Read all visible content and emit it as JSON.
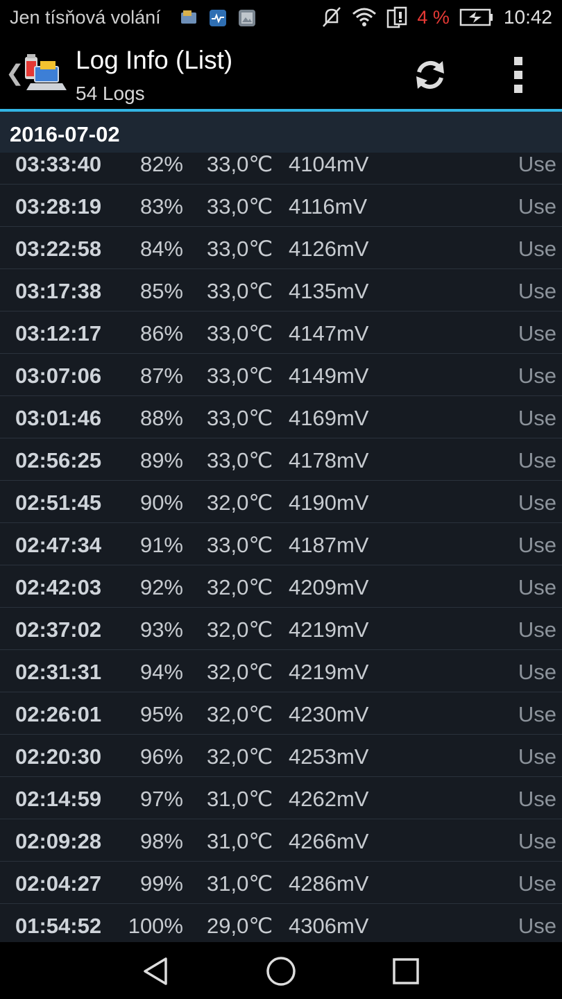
{
  "status_bar": {
    "carrier": "Jen tísňová volání",
    "battery_pct": "4 %",
    "time": "10:42",
    "notification_icons": [
      "sd-card-icon",
      "health-icon",
      "image-icon"
    ],
    "system_icons": [
      "mute-icon",
      "wifi-icon",
      "sim-icon",
      "battery-charging-icon"
    ]
  },
  "action_bar": {
    "title": "Log Info (List)",
    "subtitle": "54 Logs",
    "accent_color": "#33b5e5"
  },
  "section": {
    "date": "2016-07-02"
  },
  "rows": [
    {
      "time": "03:33:40",
      "pct": "82%",
      "temp": "33,0℃",
      "mv": "4104mV",
      "use": "Use"
    },
    {
      "time": "03:28:19",
      "pct": "83%",
      "temp": "33,0℃",
      "mv": "4116mV",
      "use": "Use"
    },
    {
      "time": "03:22:58",
      "pct": "84%",
      "temp": "33,0℃",
      "mv": "4126mV",
      "use": "Use"
    },
    {
      "time": "03:17:38",
      "pct": "85%",
      "temp": "33,0℃",
      "mv": "4135mV",
      "use": "Use"
    },
    {
      "time": "03:12:17",
      "pct": "86%",
      "temp": "33,0℃",
      "mv": "4147mV",
      "use": "Use"
    },
    {
      "time": "03:07:06",
      "pct": "87%",
      "temp": "33,0℃",
      "mv": "4149mV",
      "use": "Use"
    },
    {
      "time": "03:01:46",
      "pct": "88%",
      "temp": "33,0℃",
      "mv": "4169mV",
      "use": "Use"
    },
    {
      "time": "02:56:25",
      "pct": "89%",
      "temp": "33,0℃",
      "mv": "4178mV",
      "use": "Use"
    },
    {
      "time": "02:51:45",
      "pct": "90%",
      "temp": "32,0℃",
      "mv": "4190mV",
      "use": "Use"
    },
    {
      "time": "02:47:34",
      "pct": "91%",
      "temp": "33,0℃",
      "mv": "4187mV",
      "use": "Use"
    },
    {
      "time": "02:42:03",
      "pct": "92%",
      "temp": "32,0℃",
      "mv": "4209mV",
      "use": "Use"
    },
    {
      "time": "02:37:02",
      "pct": "93%",
      "temp": "32,0℃",
      "mv": "4219mV",
      "use": "Use"
    },
    {
      "time": "02:31:31",
      "pct": "94%",
      "temp": "32,0℃",
      "mv": "4219mV",
      "use": "Use"
    },
    {
      "time": "02:26:01",
      "pct": "95%",
      "temp": "32,0℃",
      "mv": "4230mV",
      "use": "Use"
    },
    {
      "time": "02:20:30",
      "pct": "96%",
      "temp": "32,0℃",
      "mv": "4253mV",
      "use": "Use"
    },
    {
      "time": "02:14:59",
      "pct": "97%",
      "temp": "31,0℃",
      "mv": "4262mV",
      "use": "Use"
    },
    {
      "time": "02:09:28",
      "pct": "98%",
      "temp": "31,0℃",
      "mv": "4266mV",
      "use": "Use"
    },
    {
      "time": "02:04:27",
      "pct": "99%",
      "temp": "31,0℃",
      "mv": "4286mV",
      "use": "Use"
    },
    {
      "time": "01:54:52",
      "pct": "100%",
      "temp": "29,0℃",
      "mv": "4306mV",
      "use": "Use"
    }
  ],
  "nav_bar": {
    "icons": [
      "back-icon",
      "home-icon",
      "recents-icon"
    ]
  }
}
